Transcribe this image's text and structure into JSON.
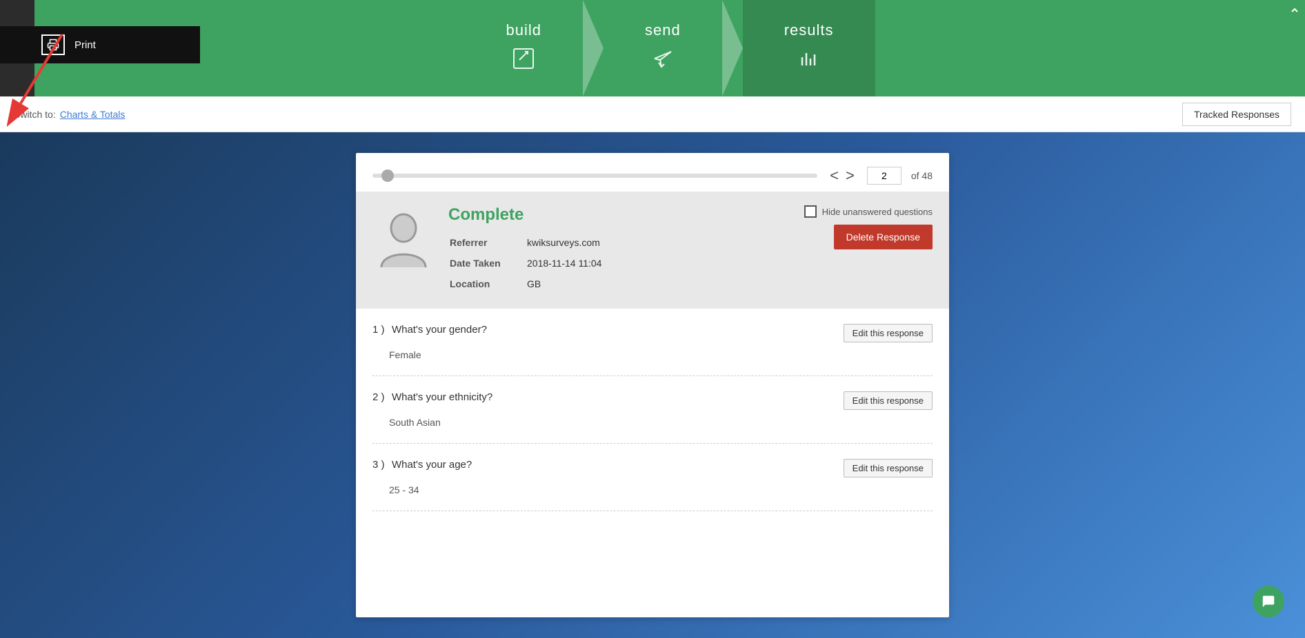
{
  "nav": {
    "steps": [
      {
        "id": "build",
        "label": "build",
        "icon": "✎",
        "active": false
      },
      {
        "id": "send",
        "label": "send",
        "icon": "✈",
        "active": false
      },
      {
        "id": "results",
        "label": "results",
        "icon": "▐▌▐",
        "active": true
      }
    ]
  },
  "toolbar": {
    "switch_prefix": "Switch to:",
    "switch_link": "Charts & Totals",
    "tracked_responses": "Tracked Responses"
  },
  "print_tooltip": {
    "label": "Print"
  },
  "response": {
    "status": "Complete",
    "referrer_label": "Referrer",
    "referrer_value": "kwiksurveys.com",
    "date_label": "Date Taken",
    "date_value": "2018-11-14 11:04",
    "location_label": "Location",
    "location_value": "GB",
    "hide_unanswered_label": "Hide unanswered questions",
    "delete_button": "Delete Response",
    "current_page": "2",
    "total_pages": "of 48"
  },
  "questions": [
    {
      "number": "1",
      "text": "What's your gender?",
      "answer": "Female",
      "edit_label": "Edit this response"
    },
    {
      "number": "2",
      "text": "What's your ethnicity?",
      "answer": "South Asian",
      "edit_label": "Edit this response"
    },
    {
      "number": "3",
      "text": "What's your age?",
      "answer": "25 - 34",
      "edit_label": "Edit this response"
    }
  ]
}
